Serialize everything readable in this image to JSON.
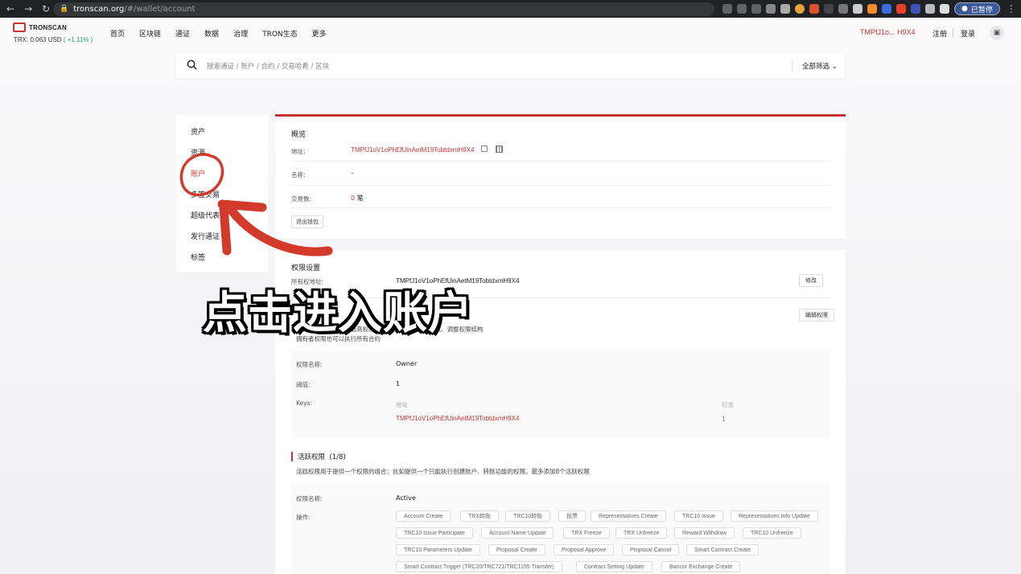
{
  "browser": {
    "url_host": "tronscan.org",
    "url_path": "/#/wallet/account",
    "profile_label": "已暂停",
    "nav_icons": [
      "back-icon",
      "forward-icon",
      "reload-icon"
    ]
  },
  "header": {
    "logo_text": "TRONSCAN",
    "price_label": "TRX: 0.063 USD",
    "price_change": "( +1.11% )",
    "nav": [
      "首页",
      "区块链",
      "通证",
      "数据",
      "治理",
      "TRON生态",
      "更多"
    ],
    "account_short": "TMPfJ1o... H9X4",
    "register": "注册",
    "login": "登录"
  },
  "search": {
    "placeholder": "搜索通证 / 账户 / 合约 / 交易哈希 / 区块",
    "filter": "全部筛选"
  },
  "sidebar": {
    "items": [
      "资产",
      "资源",
      "账户",
      "多签交易",
      "超级代表",
      "发行通证",
      "标签"
    ],
    "active_index": 2
  },
  "overview": {
    "title": "概览",
    "address_label": "地址:",
    "address": "TMPfJ1oV1oPhEfUinAetM19TobtdxmH9X4",
    "name_label": "名称:",
    "name_value": "–",
    "tx_label": "交易数:",
    "tx_count": "0",
    "tx_unit": "笔",
    "logout": "退出钱包"
  },
  "permissions": {
    "title": "权限设置",
    "owner_label": "所有权地址:",
    "owner_address": "TMPfJ1oV1oPhEfUinAetM19TobtdxmH9X4",
    "modify": "修改",
    "edit": "编辑权限",
    "desc1": "拥有者权限是账户的最高权限，用于控制用户的所有权、调整权限结构",
    "desc2": "拥有者权限也可以执行所有合约",
    "owner_box": {
      "name_label": "权限名称:",
      "name": "Owner",
      "threshold_label": "阈值:",
      "threshold": "1",
      "keys_label": "Keys:",
      "addr_header": "地址",
      "weight_header": "权重",
      "key_address": "TMPfJ1oV1oPhEfUinAetM19TobtdxmH9X4",
      "key_weight": "1"
    },
    "active": {
      "title": "活跃权限",
      "count": "(1/8)",
      "desc": "活跃权限用于提供一个权限的组合：比如提供一个只能执行创建账户、转账功能的权限。最多添加8个活跃权限",
      "name_label": "权限名称:",
      "name": "Active",
      "ops_label": "操作:",
      "ops": [
        "Account Create",
        "TRX转账",
        "TRC10转账",
        "投票",
        "Representatives Create",
        "TRC10 Issue",
        "Representatives Info Update",
        "TRC10 Issue Participate",
        "Account Name Update",
        "TRX Freeze",
        "TRX Unfreeze",
        "Reward Withdraw",
        "TRC10 Unfreeze",
        "TRC10 Parameters Update",
        "Proposal Create",
        "Proposal Approve",
        "Proposal Cancel",
        "Smart Contract Create",
        "Smart Contract Trigger (TRC20/TRC721/TRC1155 Transfer)",
        "Contract Setting Update",
        "Bancor Exchange Create"
      ]
    }
  },
  "annotation": {
    "caption": "点击进入账户",
    "color": "#d23a2c"
  },
  "colors": {
    "accent": "#c23631",
    "positive": "#26a17b"
  }
}
